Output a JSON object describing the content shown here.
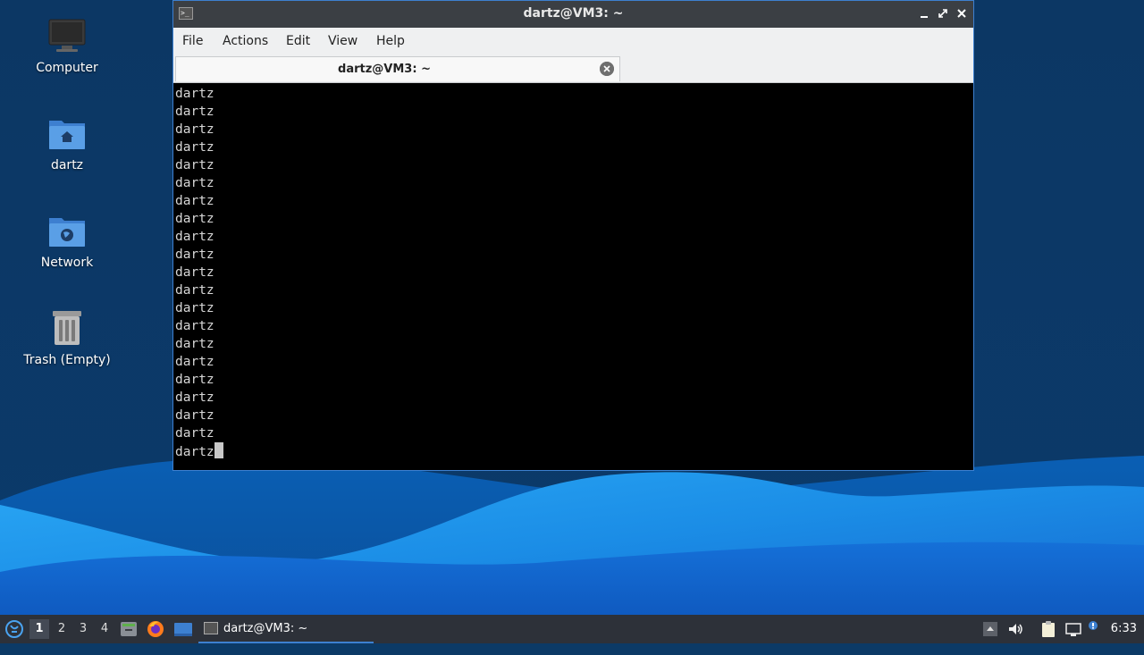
{
  "desktop": {
    "icons": [
      {
        "label": "Computer",
        "icon": "monitor-icon"
      },
      {
        "label": "dartz",
        "icon": "home-folder-icon"
      },
      {
        "label": "Network",
        "icon": "network-folder-icon"
      },
      {
        "label": "Trash (Empty)",
        "icon": "trash-icon"
      }
    ]
  },
  "window": {
    "title": "dartz@VM3: ~",
    "menu": [
      "File",
      "Actions",
      "Edit",
      "View",
      "Help"
    ],
    "tab": {
      "title": "dartz@VM3: ~"
    },
    "terminal": {
      "lines": [
        "dartz",
        "dartz",
        "dartz",
        "dartz",
        "dartz",
        "dartz",
        "dartz",
        "dartz",
        "dartz",
        "dartz",
        "dartz",
        "dartz",
        "dartz",
        "dartz",
        "dartz",
        "dartz",
        "dartz",
        "dartz",
        "dartz",
        "dartz"
      ],
      "prompt_line": "dartz"
    }
  },
  "taskbar": {
    "workspaces": [
      "1",
      "2",
      "3",
      "4"
    ],
    "active_workspace": "1",
    "task": {
      "label": "dartz@VM3: ~"
    },
    "clock": "6:33"
  },
  "colors": {
    "accent": "#3d80d0",
    "wallpaper_dark": "#0c3a66",
    "wallpaper_wave": "#1c8ee8",
    "taskbar": "#2d3139"
  }
}
